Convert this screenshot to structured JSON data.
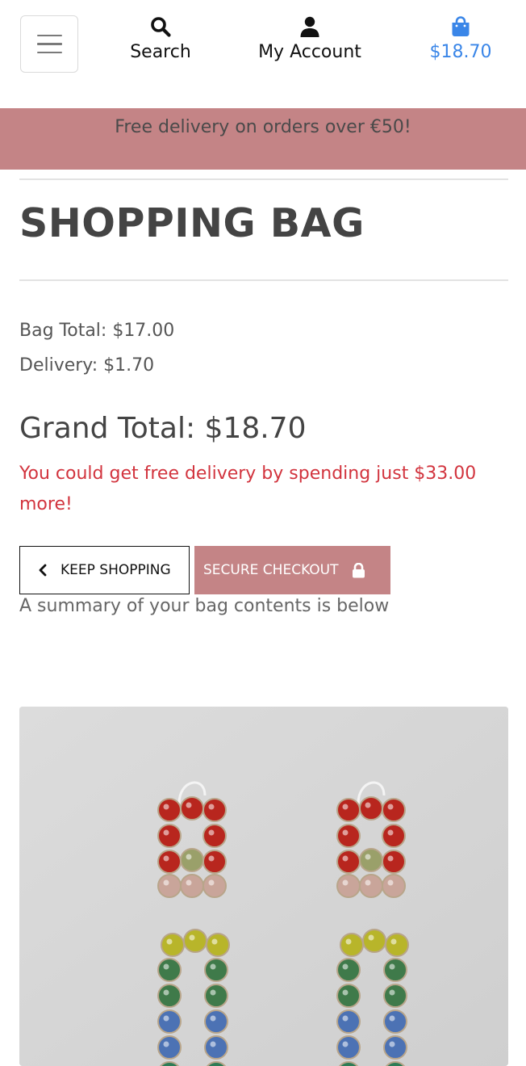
{
  "header": {
    "search_label": "Search",
    "account_label": "My Account",
    "bag_total": "$18.70",
    "bag_color": "#3a86e8",
    "icons": {
      "menu": "hamburger-icon",
      "search": "search-icon",
      "account": "user-icon",
      "bag": "shopping-bag-icon"
    }
  },
  "banner": {
    "text": "Free delivery on orders over €50!",
    "color": "#c48486"
  },
  "page": {
    "title": "SHOPPING BAG"
  },
  "totals": {
    "bag_total": "Bag Total: $17.00",
    "delivery": "Delivery: $1.70",
    "grand_total": "Grand Total: $18.70",
    "free_delivery_notice": "You could get free delivery by spending just $33.00 more!",
    "notice_color": "#d2343e"
  },
  "actions": {
    "keep_shopping": "KEEP SHOPPING",
    "secure_checkout": "SECURE CHECKOUT",
    "icons": {
      "keep_shopping": "chevron-left-icon",
      "secure_checkout": "lock-icon"
    }
  },
  "summary": {
    "text": "A summary of your bag contents is below"
  },
  "product": {
    "image_desc": "multicolour rhinestone earrings"
  }
}
